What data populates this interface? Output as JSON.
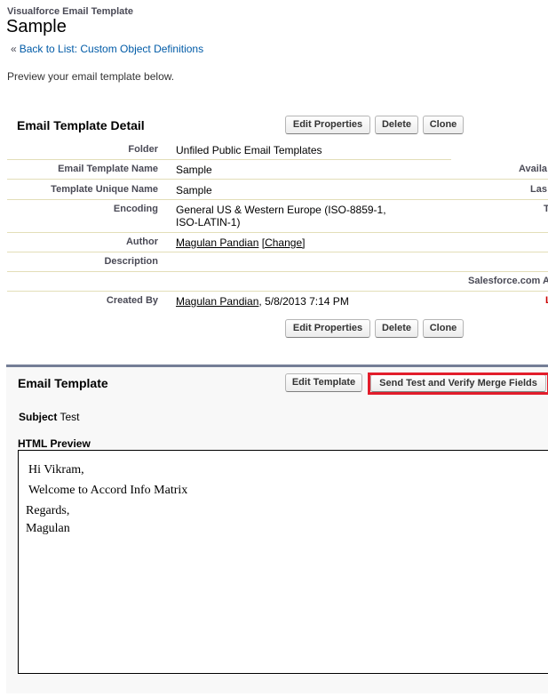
{
  "header": {
    "eyebrow": "Visualforce Email Template",
    "title": "Sample",
    "back_prefix": "«",
    "back_link": "Back to List: Custom Object Definitions",
    "intro": "Preview your email template below."
  },
  "detail": {
    "title": "Email Template Detail",
    "buttons": {
      "edit": "Edit Properties",
      "delete": "Delete",
      "clone": "Clone"
    },
    "fields": [
      {
        "label": "Folder",
        "value": "Unfiled Public Email Templates"
      },
      {
        "label": "Email Template Name",
        "value": "Sample"
      },
      {
        "label": "Template Unique Name",
        "value": "Sample"
      },
      {
        "label": "Encoding",
        "value_line1": "General US & Western Europe (ISO-8859-1,",
        "value_line2": "ISO-LATIN-1)"
      },
      {
        "label": "Author",
        "value": "Magulan Pandian",
        "change": "[Change]"
      },
      {
        "label": "Description",
        "value": ""
      },
      {
        "label": "Created By",
        "value": "Magulan Pandian",
        "suffix": ", 5/8/2013 7:14 PM"
      }
    ],
    "right_labels": [
      "Availa",
      "Las",
      "T",
      "Salesforce.com A",
      "L"
    ]
  },
  "email_template": {
    "title": "Email Template",
    "edit_button": "Edit Template",
    "send_button": "Send Test and Verify Merge Fields",
    "subject_label": "Subject",
    "subject_value": "Test",
    "preview_label": "HTML Preview",
    "preview_lines": [
      "Hi Vikram,",
      "Welcome to Accord Info Matrix",
      "Regards,",
      "Magulan"
    ]
  },
  "colors": {
    "highlight": "#e21d2b",
    "link": "#015ba7",
    "section_border": "#747e96"
  }
}
